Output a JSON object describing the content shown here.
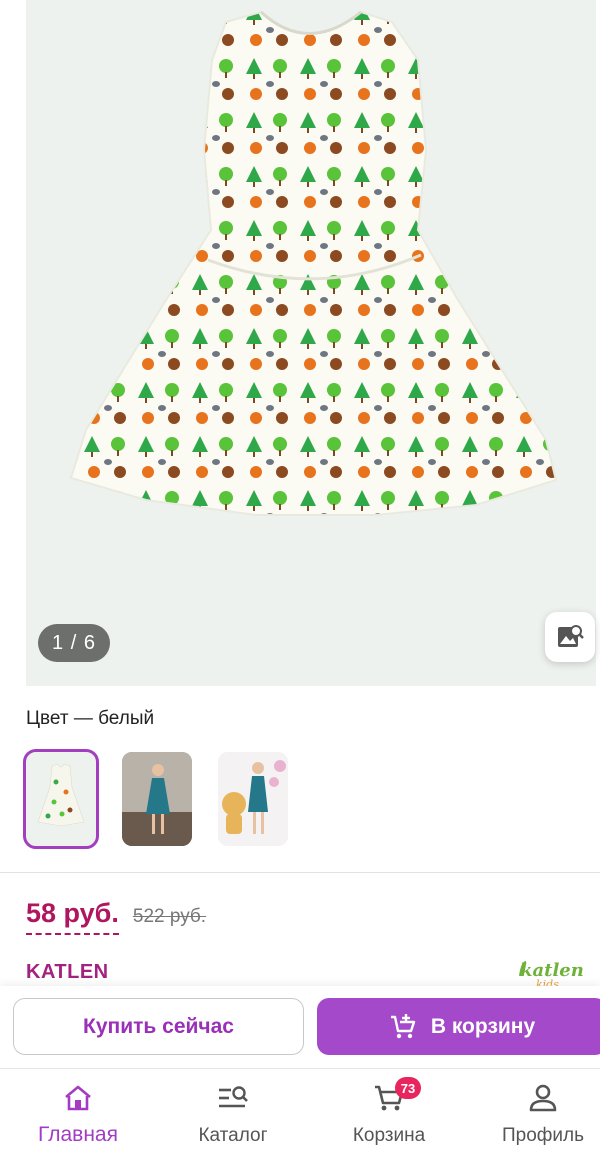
{
  "gallery": {
    "counter_current": "1",
    "counter_total": "6",
    "counter_text": "1 / 6",
    "image_search_icon": "image-search-icon"
  },
  "color": {
    "label": "Цвет — белый",
    "thumbnails": [
      "dress-white-thumb",
      "girl-wearing-dress-thumb",
      "girl-with-gingerbread-thumb"
    ],
    "selected_index": 0
  },
  "price": {
    "current": "58 руб.",
    "old": "522 руб."
  },
  "brand": {
    "name": "KATLEN",
    "logo_text": "katlen kids"
  },
  "actions": {
    "buy_now": "Купить сейчас",
    "add_to_cart": "В корзину"
  },
  "nav": {
    "items": [
      {
        "label": "Главная",
        "icon": "home-icon",
        "active": true
      },
      {
        "label": "Каталог",
        "icon": "catalog-search-icon",
        "active": false
      },
      {
        "label": "Корзина",
        "icon": "cart-icon",
        "active": false,
        "badge": "73"
      },
      {
        "label": "Профиль",
        "icon": "profile-icon",
        "active": false
      }
    ]
  },
  "colors": {
    "accent": "#a349c9",
    "price": "#b0165e",
    "brand": "#a4227f",
    "badge": "#e8255d"
  }
}
